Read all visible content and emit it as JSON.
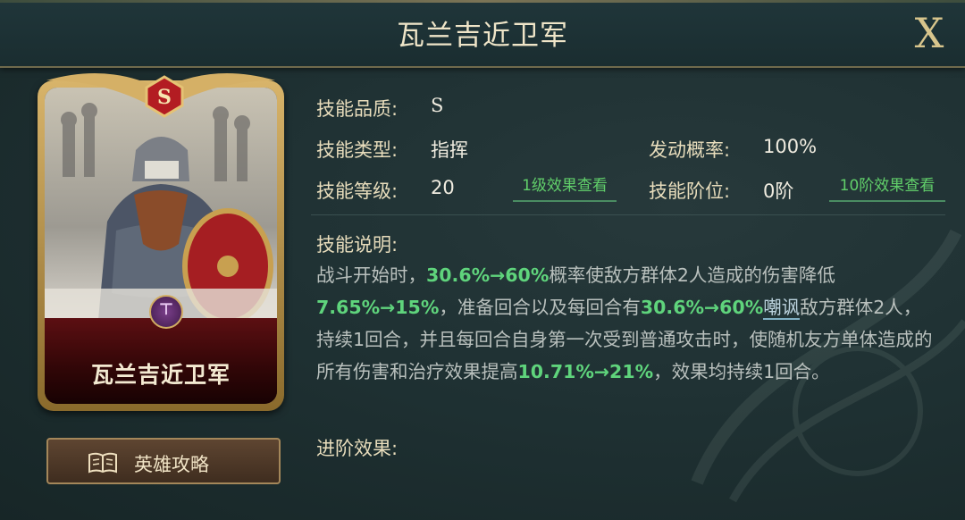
{
  "title": "瓦兰吉近卫军",
  "close_label": "X",
  "card": {
    "name": "瓦兰吉近卫军",
    "grade": "S"
  },
  "guide_button": {
    "label": "英雄攻略",
    "icon": "book-icon"
  },
  "stats": {
    "quality_label": "技能品质:",
    "quality_value": "S",
    "type_label": "技能类型:",
    "type_value": "指挥",
    "chance_label": "发动概率:",
    "chance_value": "100%",
    "level_label": "技能等级:",
    "level_value": "20",
    "level_link": "1级效果查看",
    "rank_label": "技能阶位:",
    "rank_value": "0阶",
    "rank_link": "10阶效果查看"
  },
  "description": {
    "label": "技能说明:",
    "p1": "战斗开始时，",
    "g1": "30.6%→60%",
    "p2": "概率使敌方群体2人造成的伤害降低",
    "g2": "7.65%→15%",
    "p3": "，准备回合以及每回合有",
    "g3": "30.6%→60%",
    "taunt": "嘲讽",
    "p4": "敌方群体2人，持续1回合，并且每回合自身第一次受到普通攻击时，使随机友方单体造成的所有伤害和治疗效果提高",
    "g4": "10.71%→21%",
    "p5": "，效果均持续1回合。"
  },
  "advance": {
    "label": "进阶效果:"
  },
  "colors": {
    "accent_green": "#5fd47c",
    "gold": "#d8b46a",
    "background": "#1f3133"
  }
}
